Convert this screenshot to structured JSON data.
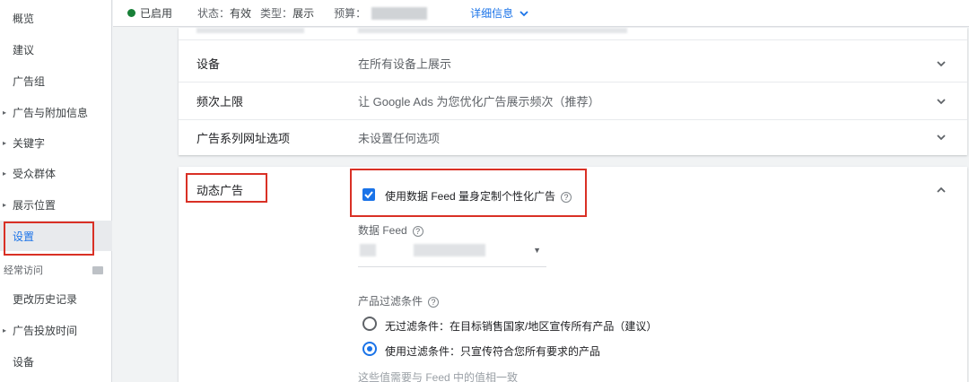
{
  "sidebar": {
    "items": [
      {
        "label": "概览",
        "arrow": false
      },
      {
        "label": "建议",
        "arrow": false
      },
      {
        "label": "广告组",
        "arrow": false
      },
      {
        "label": "广告与附加信息",
        "arrow": true
      },
      {
        "label": "关键字",
        "arrow": true
      },
      {
        "label": "受众群体",
        "arrow": true
      },
      {
        "label": "展示位置",
        "arrow": true
      },
      {
        "label": "设置",
        "arrow": false,
        "active": true
      }
    ],
    "section_label": "经常访问",
    "recent": [
      {
        "label": "更改历史记录",
        "arrow": false
      },
      {
        "label": "广告投放时间",
        "arrow": true
      },
      {
        "label": "设备",
        "arrow": false
      }
    ]
  },
  "status": {
    "enabled": "已启用",
    "state_label": "状态：",
    "state_value": "有效",
    "type_label": "类型：",
    "type_value": "展示",
    "budget_label": "预算：",
    "details_link": "详细信息",
    "enabled_color": "#188038"
  },
  "settings_rows": [
    {
      "label": "设备",
      "value": "在所有设备上展示"
    },
    {
      "label": "频次上限",
      "value": "让 Google Ads 为您优化广告展示频次（推荐）"
    },
    {
      "label": "广告系列网址选项",
      "value": "未设置任何选项"
    }
  ],
  "dynamic_ads": {
    "title": "动态广告",
    "checkbox_label": "使用数据 Feed 量身定制个性化广告",
    "checkbox_checked": true,
    "feed_label": "数据 Feed",
    "filter_label": "产品过滤条件",
    "options": [
      {
        "label": "无过滤条件：在目标销售国家/地区宣传所有产品（建议）",
        "selected": false
      },
      {
        "label": "使用过滤条件：只宣传符合您所有要求的产品",
        "selected": true
      }
    ],
    "footer_hint": "这些值需要与 Feed 中的值相一致"
  },
  "accent_color": "#1a73e8",
  "highlight_color": "#d93025"
}
